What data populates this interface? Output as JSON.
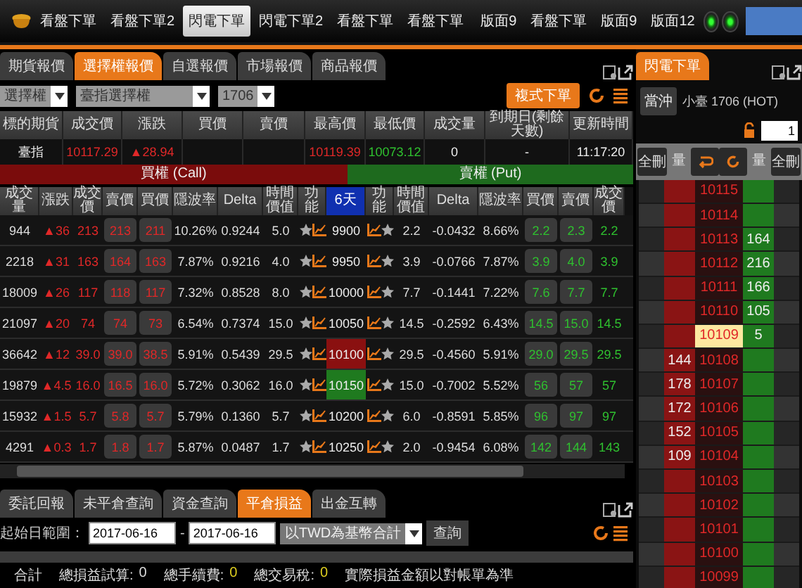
{
  "top_menu": {
    "items": [
      {
        "label": "看盤下單",
        "selected": false
      },
      {
        "label": "看盤下單2",
        "selected": false
      },
      {
        "label": "閃電下單",
        "selected": true
      },
      {
        "label": "閃電下單2",
        "selected": false
      },
      {
        "label": "看盤下單",
        "selected": false
      },
      {
        "label": "看盤下單",
        "selected": false
      },
      {
        "label": "版面9",
        "selected": false
      },
      {
        "label": "看盤下單",
        "selected": false
      },
      {
        "label": "版面9",
        "selected": false
      },
      {
        "label": "版面12",
        "selected": false
      }
    ]
  },
  "quote_panel": {
    "tabs": [
      {
        "label": "期貨報價",
        "selected": false
      },
      {
        "label": "選擇權報價",
        "selected": true
      },
      {
        "label": "自選報價",
        "selected": false
      },
      {
        "label": "市場報價",
        "selected": false
      },
      {
        "label": "商品報價",
        "selected": false
      }
    ],
    "selectors": {
      "product": "選擇權",
      "underlying": "臺指選擇權",
      "month": "1706"
    },
    "complex_order_button": "複式下單",
    "summary": {
      "columns": [
        "標的期貨",
        "成交價",
        "漲跌",
        "買價",
        "賣價",
        "最高價",
        "最低價",
        "成交量",
        "到期日(剩餘天數)",
        "更新時間"
      ],
      "row": {
        "underlying": "臺指",
        "last": "10117.29",
        "change": "▲28.94",
        "high": "10119.39",
        "low": "10073.12",
        "volume": "0",
        "expiry": "-",
        "time": "11:17:20"
      }
    },
    "call_label": "買權 (Call)",
    "put_label": "賣權 (Put)",
    "columns": [
      "成交量",
      "漲跌",
      "成交價",
      "賣價",
      "買價",
      "隱波率",
      "Delta",
      "時間價值",
      "功能",
      "6天",
      "功能",
      "時間價值",
      "Delta",
      "隱波率",
      "買價",
      "賣價",
      "成交價"
    ],
    "rows": [
      {
        "call": {
          "volume": "944",
          "change": "▲36",
          "last": "213",
          "ask": "213",
          "bid": "211",
          "iv": "10.26%",
          "delta": "0.9244",
          "time_value": "5.0"
        },
        "strike": "9900",
        "put": {
          "time_value": "2.2",
          "delta": "-0.0432",
          "iv": "8.66%",
          "bid": "2.2",
          "ask": "2.3",
          "last": "2.2"
        }
      },
      {
        "call": {
          "volume": "2218",
          "change": "▲31",
          "last": "163",
          "ask": "164",
          "bid": "163",
          "iv": "7.87%",
          "delta": "0.9216",
          "time_value": "4.0"
        },
        "strike": "9950",
        "put": {
          "time_value": "3.9",
          "delta": "-0.0766",
          "iv": "7.87%",
          "bid": "3.9",
          "ask": "4.0",
          "last": "3.9"
        }
      },
      {
        "call": {
          "volume": "18009",
          "change": "▲26",
          "last": "117",
          "ask": "118",
          "bid": "117",
          "iv": "7.32%",
          "delta": "0.8528",
          "time_value": "8.0"
        },
        "strike": "10000",
        "put": {
          "time_value": "7.7",
          "delta": "-0.1441",
          "iv": "7.22%",
          "bid": "7.6",
          "ask": "7.7",
          "last": "7.7"
        }
      },
      {
        "call": {
          "volume": "21097",
          "change": "▲20",
          "last": "74",
          "ask": "74",
          "bid": "73",
          "iv": "6.54%",
          "delta": "0.7374",
          "time_value": "15.0"
        },
        "strike": "10050",
        "put": {
          "time_value": "14.5",
          "delta": "-0.2592",
          "iv": "6.43%",
          "bid": "14.5",
          "ask": "15.0",
          "last": "14.5"
        }
      },
      {
        "call": {
          "volume": "36642",
          "change": "▲12",
          "last": "39.0",
          "ask": "39.0",
          "bid": "38.5",
          "iv": "5.91%",
          "delta": "0.5439",
          "time_value": "29.5"
        },
        "strike": "10100",
        "color": "#8a1010",
        "put": {
          "time_value": "29.5",
          "delta": "-0.4560",
          "iv": "5.91%",
          "bid": "29.0",
          "ask": "29.5",
          "last": "29.5"
        }
      },
      {
        "call": {
          "volume": "19879",
          "change": "▲4.5",
          "last": "16.0",
          "ask": "16.5",
          "bid": "16.0",
          "iv": "5.72%",
          "delta": "0.3062",
          "time_value": "16.0"
        },
        "strike": "10150",
        "color": "#1f7a1f",
        "put": {
          "time_value": "15.0",
          "delta": "-0.7002",
          "iv": "5.52%",
          "bid": "56",
          "ask": "57",
          "last": "57"
        }
      },
      {
        "call": {
          "volume": "15932",
          "change": "▲1.5",
          "last": "5.7",
          "ask": "5.8",
          "bid": "5.7",
          "iv": "5.79%",
          "delta": "0.1360",
          "time_value": "5.7"
        },
        "strike": "10200",
        "put": {
          "time_value": "6.0",
          "delta": "-0.8591",
          "iv": "5.85%",
          "bid": "96",
          "ask": "97",
          "last": "97"
        }
      },
      {
        "call": {
          "volume": "4291",
          "change": "▲0.3",
          "last": "1.7",
          "ask": "1.8",
          "bid": "1.7",
          "iv": "5.87%",
          "delta": "0.0487",
          "time_value": "1.7"
        },
        "strike": "10250",
        "put": {
          "time_value": "2.0",
          "delta": "-0.9454",
          "iv": "6.08%",
          "bid": "142",
          "ask": "144",
          "last": "143"
        }
      }
    ]
  },
  "account_panel": {
    "tabs": [
      {
        "label": "委託回報",
        "selected": false
      },
      {
        "label": "未平倉查詢",
        "selected": false
      },
      {
        "label": "資金查詢",
        "selected": false
      },
      {
        "label": "平倉損益",
        "selected": true
      },
      {
        "label": "出金互轉",
        "selected": false
      }
    ],
    "date_label": "起始日範圍：",
    "date_from": "2017-06-16",
    "date_separator": "-",
    "date_to": "2017-06-16",
    "currency": "以TWD為基幣合計",
    "query_button": "查詢",
    "totals": [
      {
        "label": "合計"
      },
      {
        "label": "總損益試算:",
        "value": "0",
        "highlighted": false
      },
      {
        "label": "總手續費:",
        "value": "0",
        "highlighted": true
      },
      {
        "label": "總交易稅:",
        "value": "0",
        "highlighted": true
      },
      {
        "label": "實際損益金額以對帳單為準"
      }
    ]
  },
  "flash_panel": {
    "tab": "閃電下單",
    "day_trade_button": "當沖",
    "product": "小臺 1706 (HOT)",
    "quantity": "1",
    "ladder_header": [
      "全刪",
      "量",
      "量",
      "全刪"
    ],
    "ladder": [
      {
        "price": "10115",
        "selected": false
      },
      {
        "price": "10114",
        "selected": false
      },
      {
        "price": "10113",
        "ask": "164",
        "selected": false
      },
      {
        "price": "10112",
        "ask": "216",
        "selected": false
      },
      {
        "price": "10111",
        "ask": "166",
        "selected": false
      },
      {
        "price": "10110",
        "ask": "105",
        "selected": false
      },
      {
        "price": "10109",
        "ask": "5",
        "selected": true
      },
      {
        "price": "10108",
        "bid": "144",
        "selected": false
      },
      {
        "price": "10107",
        "bid": "178",
        "selected": false
      },
      {
        "price": "10106",
        "bid": "172",
        "selected": false
      },
      {
        "price": "10105",
        "bid": "152",
        "selected": false
      },
      {
        "price": "10104",
        "bid": "109",
        "selected": false
      },
      {
        "price": "10103",
        "selected": false
      },
      {
        "price": "10102",
        "selected": false
      },
      {
        "price": "10101",
        "selected": false
      },
      {
        "price": "10100",
        "selected": false
      },
      {
        "price": "10099",
        "selected": false
      }
    ]
  }
}
